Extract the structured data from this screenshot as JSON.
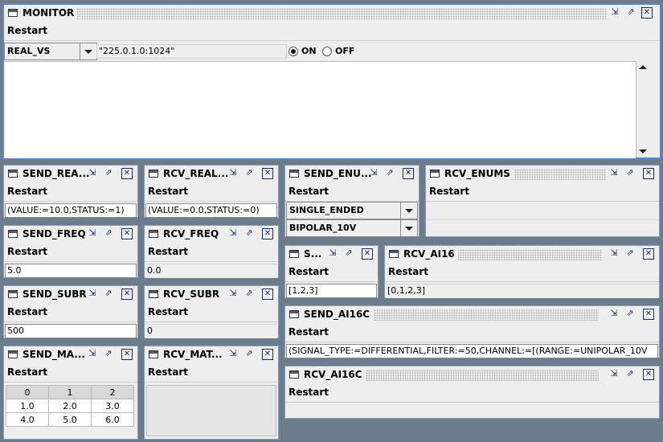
{
  "monitor": {
    "title": "MONITOR",
    "menu": "Restart",
    "type_select": "REAL_VS",
    "address": "\"225.0.1.0:1024\"",
    "on_label": "ON",
    "off_label": "OFF",
    "radio_selected": "ON"
  },
  "send_real": {
    "title": "SEND_REA...",
    "menu": "Restart",
    "value": "(VALUE:=10.0,STATUS:=1)"
  },
  "rcv_real": {
    "title": "RCV_REAL...",
    "menu": "Restart",
    "value": "(VALUE:=0.0,STATUS:=0)"
  },
  "send_enums": {
    "title": "SEND_ENU...",
    "menu": "Restart",
    "select1": "SINGLE_ENDED",
    "select2": "BIPOLAR_10V"
  },
  "rcv_enums": {
    "title": "RCV_ENUMS",
    "menu": "Restart"
  },
  "send_freq": {
    "title": "SEND_FREQ",
    "menu": "Restart",
    "value": "5.0"
  },
  "rcv_freq": {
    "title": "RCV_FREQ",
    "menu": "Restart",
    "value": "0.0"
  },
  "send_ai16": {
    "title": "S...",
    "menu": "Restart",
    "value": "[1,2,3]"
  },
  "rcv_ai16": {
    "title": "RCV_AI16",
    "menu": "Restart",
    "value": "[0,1,2,3]"
  },
  "send_subr": {
    "title": "SEND_SUBR",
    "menu": "Restart",
    "value": "500"
  },
  "rcv_subr": {
    "title": "RCV_SUBR",
    "menu": "Restart",
    "value": "0"
  },
  "send_ai16c": {
    "title": "SEND_AI16C",
    "menu": "Restart",
    "value": "(SIGNAL_TYPE:=DIFFERENTIAL,FILTER:=50,CHANNEL:=[(RANGE:=UNIPOLAR_10V"
  },
  "rcv_ai16c": {
    "title": "RCV_AI16C",
    "menu": "Restart"
  },
  "send_matrix": {
    "title": "SEND_MA...",
    "menu": "Restart",
    "headers": [
      "0",
      "1",
      "2"
    ],
    "rows": [
      [
        "1.0",
        "2.0",
        "3.0"
      ],
      [
        "4.0",
        "5.0",
        "6.0"
      ]
    ]
  },
  "rcv_matrix": {
    "title": "RCV_MAT...",
    "menu": "Restart"
  },
  "icons": {
    "window": "window-icon",
    "iconify": "iconify-icon",
    "maximize": "maximize-icon",
    "close": "close-icon",
    "dropdown": "chevron-down-icon",
    "scroll_up": "scroll-up-arrow-icon",
    "scroll_down": "scroll-down-arrow-icon"
  },
  "colors": {
    "desktop": "#6d7c8d",
    "active_border": "#5f86c4",
    "panel": "#eeeeee"
  }
}
